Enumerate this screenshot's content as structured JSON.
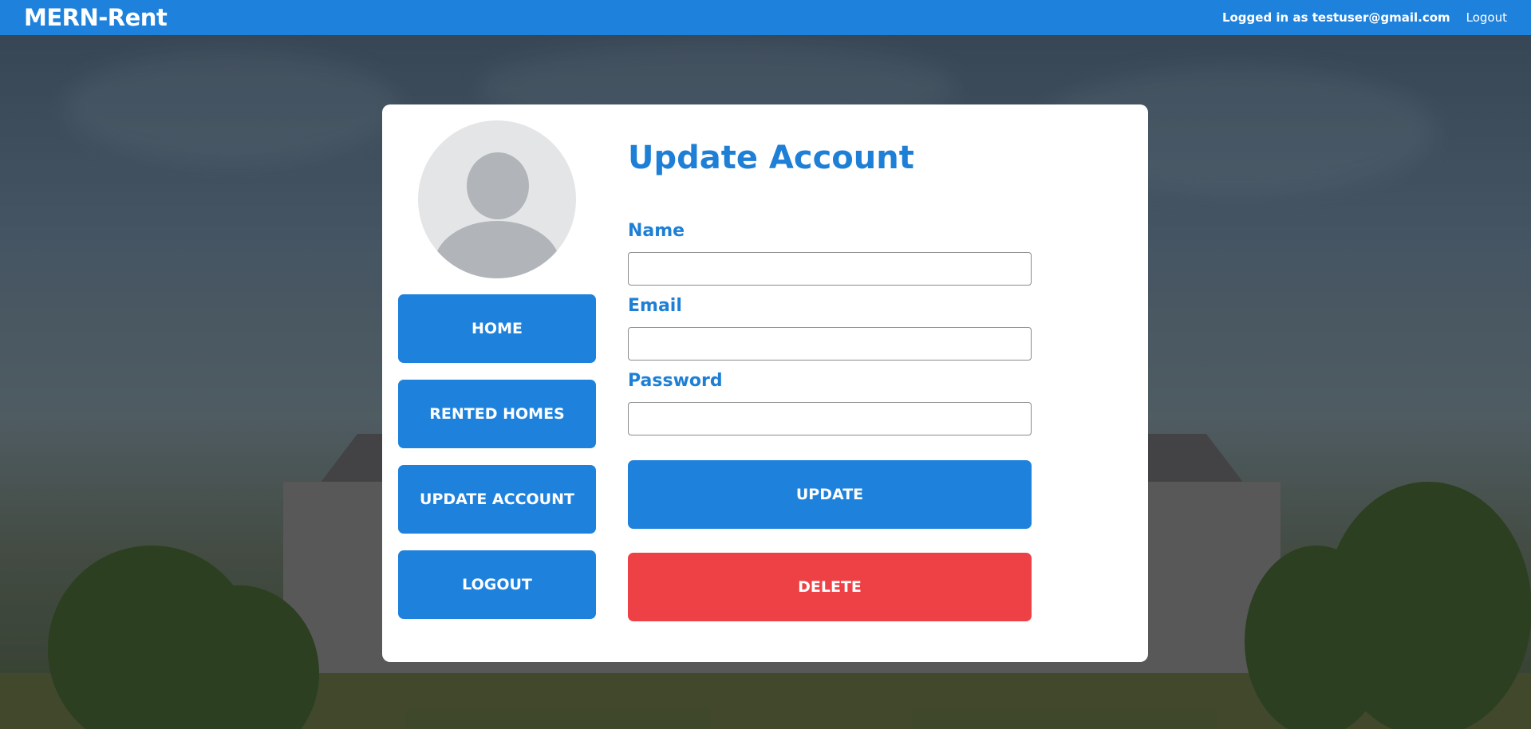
{
  "header": {
    "brand": "MERN-Rent",
    "logged_in_text": "Logged in as testuser@gmail.com",
    "logout_label": "Logout"
  },
  "sidebar": {
    "items": [
      {
        "label": "HOME"
      },
      {
        "label": "RENTED HOMES"
      },
      {
        "label": "UPDATE ACCOUNT"
      },
      {
        "label": "LOGOUT"
      }
    ]
  },
  "form": {
    "title": "Update Account",
    "name_label": "Name",
    "name_value": "",
    "email_label": "Email",
    "email_value": "",
    "password_label": "Password",
    "password_value": "",
    "update_label": "UPDATE",
    "delete_label": "DELETE"
  },
  "colors": {
    "primary": "#1e82dd",
    "danger": "#ee4145",
    "title": "#1e7fd6"
  },
  "icons": {
    "avatar": "user-avatar-placeholder-icon"
  }
}
